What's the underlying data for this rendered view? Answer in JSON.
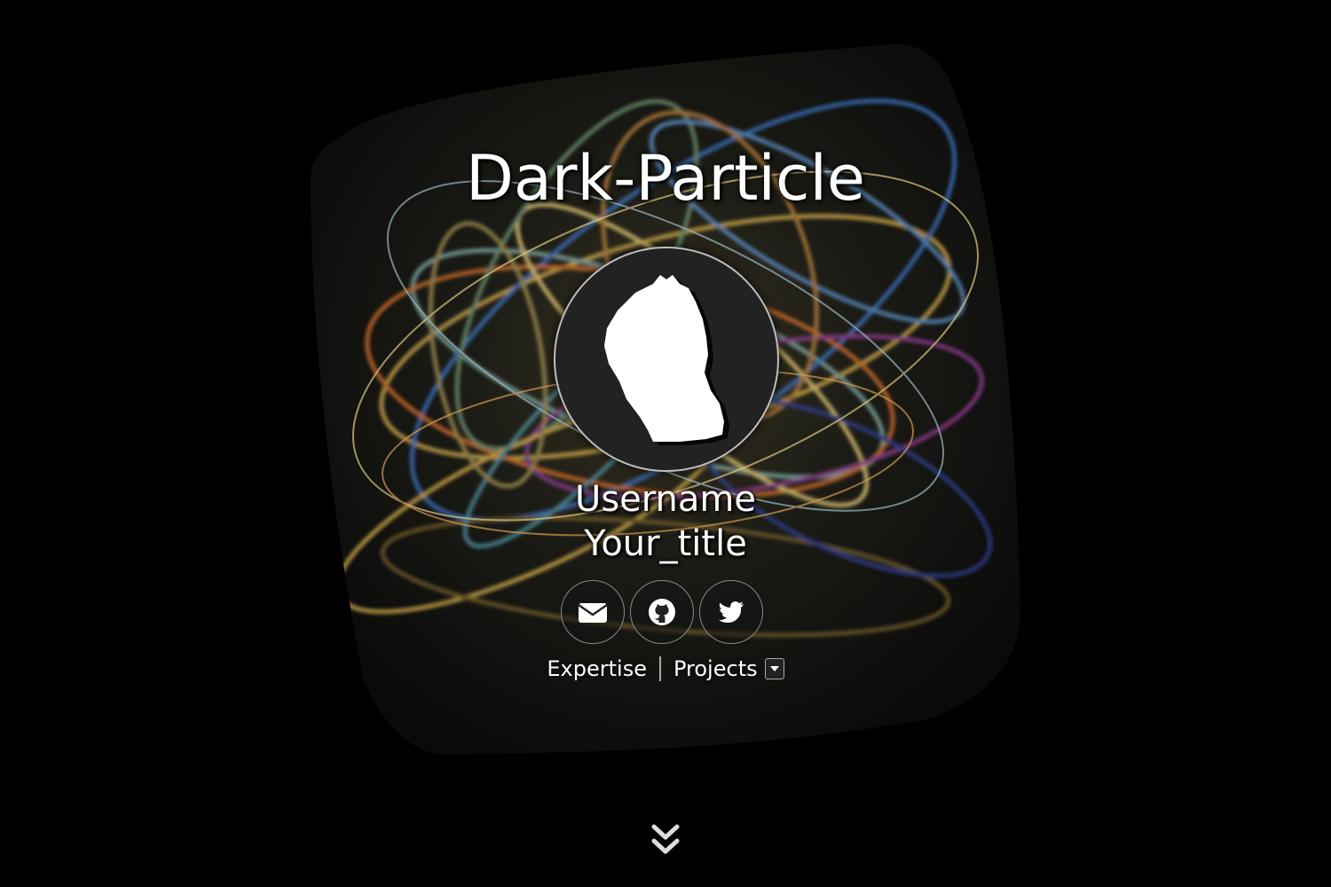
{
  "header": {
    "title": "Dark-Particle"
  },
  "profile": {
    "username": "Username",
    "title": "Your_title",
    "avatar_icon": "profile-silhouette"
  },
  "social": [
    {
      "name": "email",
      "icon": "envelope-icon"
    },
    {
      "name": "github",
      "icon": "github-icon"
    },
    {
      "name": "twitter",
      "icon": "twitter-icon"
    }
  ],
  "nav": {
    "expertise_label": "Expertise",
    "projects_label": "Projects",
    "projects_dropdown_icon": "caret-down-icon"
  },
  "scroll": {
    "icon": "double-chevron-down-icon"
  },
  "colors": {
    "background": "#000000",
    "text": "#ffffff",
    "avatar_bg": "#222222"
  }
}
